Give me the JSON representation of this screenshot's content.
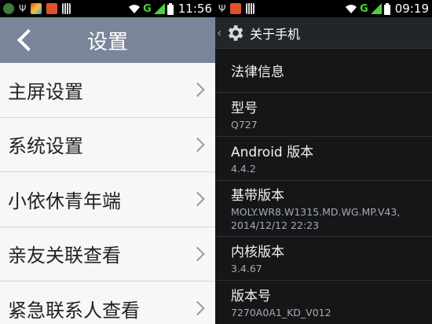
{
  "left_screen": {
    "status": {
      "time": "11:56",
      "network_letter": "G"
    },
    "title": "设置",
    "items": [
      {
        "label": "主屏设置"
      },
      {
        "label": "系统设置"
      },
      {
        "label": "小依休青年端"
      },
      {
        "label": "亲友关联查看"
      },
      {
        "label": "紧急联系人查看"
      }
    ]
  },
  "right_screen": {
    "status": {
      "time": "09:19",
      "network_letter": "G"
    },
    "title": "关于手机",
    "items": [
      {
        "title": "法律信息",
        "sub": ""
      },
      {
        "title": "型号",
        "sub": "Q727"
      },
      {
        "title": "Android 版本",
        "sub": "4.4.2"
      },
      {
        "title": "基带版本",
        "sub": "MOLY.WR8.W1315.MD.WG.MP.V43,",
        "sub2": "2014/12/12 22:23"
      },
      {
        "title": "内核版本",
        "sub": "3.4.67"
      },
      {
        "title": "版本号",
        "sub": "7270A0A1_KD_V012"
      }
    ]
  },
  "colors": {
    "left_header": "#7a8599",
    "right_bg": "#141618",
    "signal_green": "#4cd13a"
  }
}
